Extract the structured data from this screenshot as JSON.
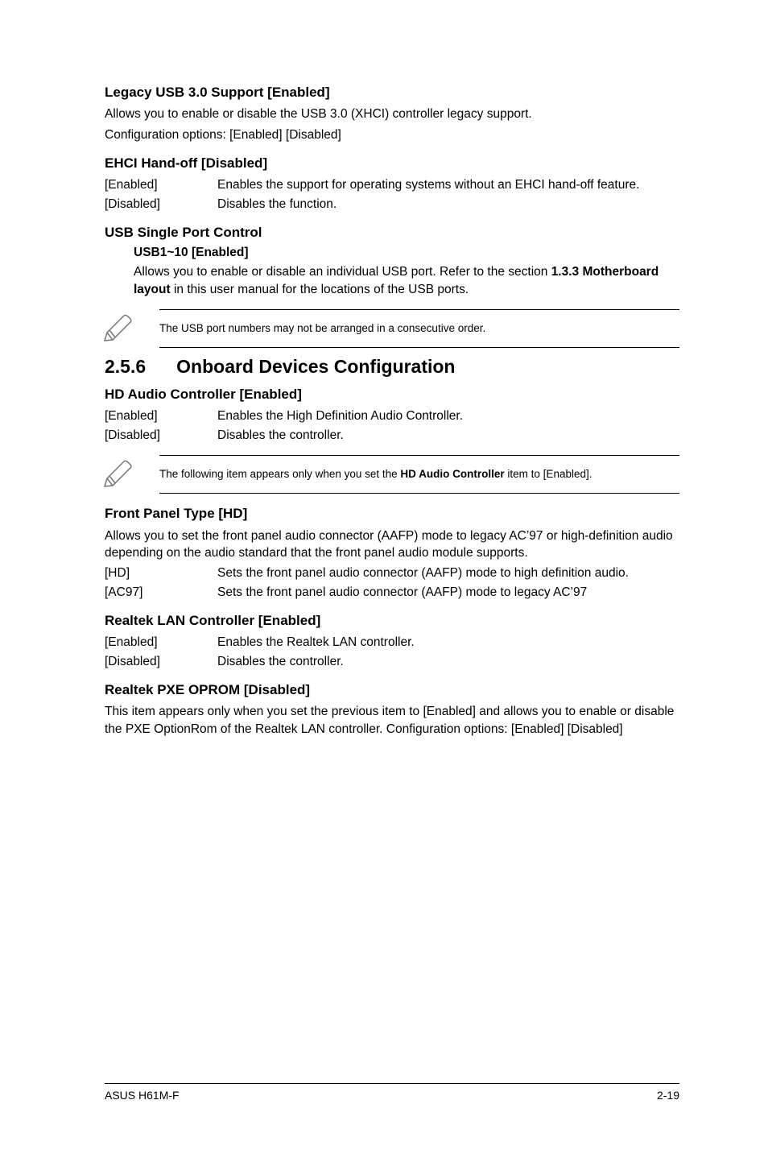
{
  "s1": {
    "title": "Legacy USB 3.0 Support [Enabled]",
    "p1": "Allows you to enable or disable the USB 3.0 (XHCI) controller legacy support.",
    "p2": "Configuration options: [Enabled] [Disabled]"
  },
  "s2": {
    "title": "EHCI Hand-off [Disabled]",
    "opt1": {
      "label": "[Enabled]",
      "text": "Enables the support for operating systems without an EHCI hand-off feature."
    },
    "opt2": {
      "label": "[Disabled]",
      "text": "Disables the function."
    }
  },
  "s3": {
    "title": "USB Single Port Control",
    "sub_title": "USB1~10 [Enabled]",
    "sub_pre": "Allows you to enable or disable an individual USB port. Refer to the section ",
    "sub_bold": "1.3.3 Motherboard layout",
    "sub_post": " in this user manual for the locations of the USB ports."
  },
  "note1": "The USB port numbers may not be arranged in a consecutive order.",
  "h2": {
    "num": "2.5.6",
    "title": "Onboard Devices Configuration"
  },
  "s4": {
    "title": "HD Audio Controller [Enabled]",
    "opt1": {
      "label": "[Enabled]",
      "text": "Enables the High Definition Audio Controller."
    },
    "opt2": {
      "label": "[Disabled]",
      "text": "Disables the controller."
    }
  },
  "note2_pre": "The following item appears only when you set the ",
  "note2_bold": "HD Audio Controller",
  "note2_post": " item to [Enabled].",
  "s5": {
    "title": "Front Panel Type [HD]",
    "p1": "Allows you to set the front panel audio connector (AAFP) mode to legacy AC’97 or high-definition audio depending on the audio standard that the front panel audio module supports.",
    "opt1": {
      "label": "[HD]",
      "text": "Sets the front panel audio connector (AAFP) mode to high definition audio."
    },
    "opt2": {
      "label": "[AC97]",
      "text": "Sets the front panel audio connector (AAFP) mode to legacy AC’97"
    }
  },
  "s6": {
    "title": "Realtek LAN Controller [Enabled]",
    "opt1": {
      "label": "[Enabled]",
      "text": "Enables the Realtek LAN controller."
    },
    "opt2": {
      "label": "[Disabled]",
      "text": "Disables the controller."
    }
  },
  "s7": {
    "title": "Realtek PXE OPROM [Disabled]",
    "p1": "This item appears only when you set the previous item to [Enabled] and allows you to enable or disable the PXE OptionRom of the Realtek LAN controller. Configuration options: [Enabled] [Disabled]"
  },
  "footer": {
    "left": "ASUS H61M-F",
    "right": "2-19"
  }
}
